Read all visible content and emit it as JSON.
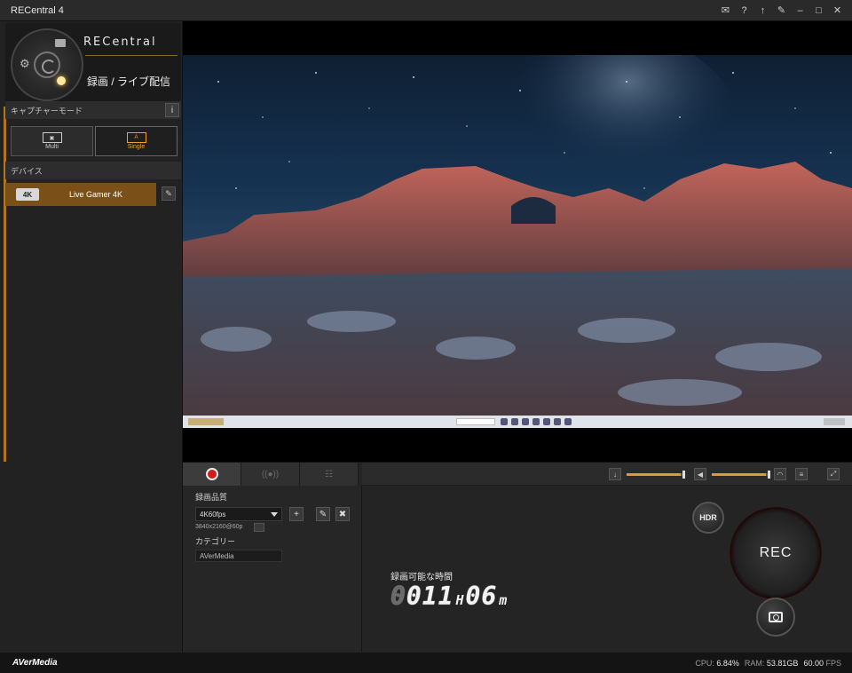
{
  "window": {
    "title": "RECentral 4",
    "buttons": [
      "pin-icon",
      "help-icon",
      "share-icon",
      "settings-icon",
      "minimize-icon",
      "maximize-icon",
      "close-icon"
    ]
  },
  "brand": {
    "logo": "RECentral",
    "mode_title": "録画 / ライブ配信"
  },
  "capture_mode": {
    "header": "キャプチャーモード",
    "info": "i",
    "options": [
      {
        "label": "Multi",
        "active": false
      },
      {
        "label": "Single",
        "active": true
      }
    ]
  },
  "devices": {
    "header": "デバイス",
    "items": [
      {
        "badge": "4K",
        "name": "Live Gamer 4K",
        "selected": true
      }
    ]
  },
  "record_settings": {
    "quality_label": "録画品質",
    "quality_value": "4K60fps",
    "resolution": "3840x2160@60p",
    "category_label": "カテゴリー",
    "category_value": "AVerMedia"
  },
  "recording": {
    "time_label": "録画可能な時間",
    "hours_dim": "0",
    "hours": "011",
    "hours_unit": "H",
    "minutes": "06",
    "minutes_unit": "m",
    "hdr_label": "HDR",
    "rec_label": "REC"
  },
  "audio": {
    "mic_level": 0.95,
    "speaker_level": 0.96
  },
  "status": {
    "brand": "AVerMedia",
    "cpu_label": "CPU:",
    "cpu_value": "6.84%",
    "ram_label": "RAM:",
    "ram_value": "53.81GB",
    "fps_value": "60.00",
    "fps_label": "FPS"
  },
  "colors": {
    "accent": "#e39a2b",
    "rec_red": "#d61a1a",
    "selected_device": "#7a5018"
  }
}
